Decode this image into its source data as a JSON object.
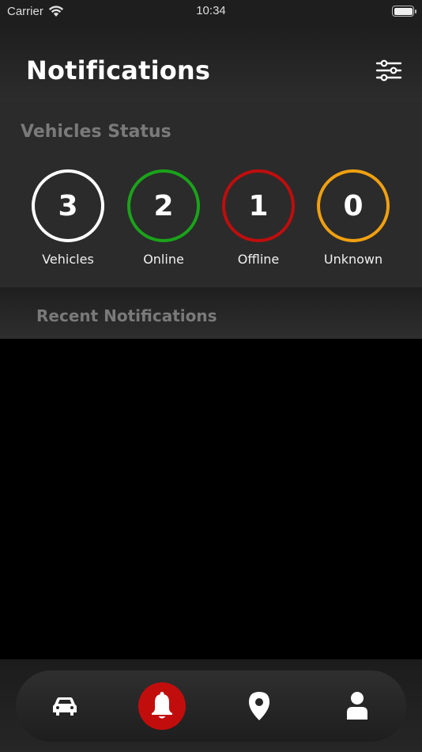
{
  "status_bar": {
    "carrier": "Carrier",
    "time": "10:34"
  },
  "header": {
    "title": "Notifications",
    "filter_icon": "sliders-icon"
  },
  "vehicles_status": {
    "title": "Vehicles Status",
    "stats": [
      {
        "value": "3",
        "label": "Vehicles",
        "color": "#ffffff"
      },
      {
        "value": "2",
        "label": "Online",
        "color": "#1aa31a"
      },
      {
        "value": "1",
        "label": "Offline",
        "color": "#c00d0d"
      },
      {
        "value": "0",
        "label": "Unknown",
        "color": "#f0a010"
      }
    ]
  },
  "recent_notifications": {
    "title": "Recent Notifications",
    "items": []
  },
  "tabbar": {
    "tabs": [
      {
        "icon": "car-icon",
        "active": false
      },
      {
        "icon": "bell-icon",
        "active": true
      },
      {
        "icon": "map-pin-icon",
        "active": false
      },
      {
        "icon": "user-icon",
        "active": false
      }
    ],
    "active_color": "#c20d0d"
  }
}
